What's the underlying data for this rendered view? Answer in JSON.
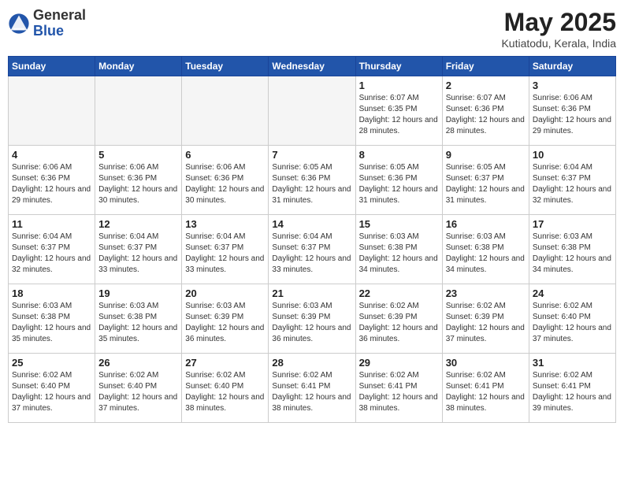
{
  "header": {
    "logo_general": "General",
    "logo_blue": "Blue",
    "month_year": "May 2025",
    "location": "Kutiatodu, Kerala, India"
  },
  "days_of_week": [
    "Sunday",
    "Monday",
    "Tuesday",
    "Wednesday",
    "Thursday",
    "Friday",
    "Saturday"
  ],
  "weeks": [
    [
      {
        "day": "",
        "info": ""
      },
      {
        "day": "",
        "info": ""
      },
      {
        "day": "",
        "info": ""
      },
      {
        "day": "",
        "info": ""
      },
      {
        "day": "1",
        "info": "Sunrise: 6:07 AM\nSunset: 6:35 PM\nDaylight: 12 hours and 28 minutes."
      },
      {
        "day": "2",
        "info": "Sunrise: 6:07 AM\nSunset: 6:36 PM\nDaylight: 12 hours and 28 minutes."
      },
      {
        "day": "3",
        "info": "Sunrise: 6:06 AM\nSunset: 6:36 PM\nDaylight: 12 hours and 29 minutes."
      }
    ],
    [
      {
        "day": "4",
        "info": "Sunrise: 6:06 AM\nSunset: 6:36 PM\nDaylight: 12 hours and 29 minutes."
      },
      {
        "day": "5",
        "info": "Sunrise: 6:06 AM\nSunset: 6:36 PM\nDaylight: 12 hours and 30 minutes."
      },
      {
        "day": "6",
        "info": "Sunrise: 6:06 AM\nSunset: 6:36 PM\nDaylight: 12 hours and 30 minutes."
      },
      {
        "day": "7",
        "info": "Sunrise: 6:05 AM\nSunset: 6:36 PM\nDaylight: 12 hours and 31 minutes."
      },
      {
        "day": "8",
        "info": "Sunrise: 6:05 AM\nSunset: 6:36 PM\nDaylight: 12 hours and 31 minutes."
      },
      {
        "day": "9",
        "info": "Sunrise: 6:05 AM\nSunset: 6:37 PM\nDaylight: 12 hours and 31 minutes."
      },
      {
        "day": "10",
        "info": "Sunrise: 6:04 AM\nSunset: 6:37 PM\nDaylight: 12 hours and 32 minutes."
      }
    ],
    [
      {
        "day": "11",
        "info": "Sunrise: 6:04 AM\nSunset: 6:37 PM\nDaylight: 12 hours and 32 minutes."
      },
      {
        "day": "12",
        "info": "Sunrise: 6:04 AM\nSunset: 6:37 PM\nDaylight: 12 hours and 33 minutes."
      },
      {
        "day": "13",
        "info": "Sunrise: 6:04 AM\nSunset: 6:37 PM\nDaylight: 12 hours and 33 minutes."
      },
      {
        "day": "14",
        "info": "Sunrise: 6:04 AM\nSunset: 6:37 PM\nDaylight: 12 hours and 33 minutes."
      },
      {
        "day": "15",
        "info": "Sunrise: 6:03 AM\nSunset: 6:38 PM\nDaylight: 12 hours and 34 minutes."
      },
      {
        "day": "16",
        "info": "Sunrise: 6:03 AM\nSunset: 6:38 PM\nDaylight: 12 hours and 34 minutes."
      },
      {
        "day": "17",
        "info": "Sunrise: 6:03 AM\nSunset: 6:38 PM\nDaylight: 12 hours and 34 minutes."
      }
    ],
    [
      {
        "day": "18",
        "info": "Sunrise: 6:03 AM\nSunset: 6:38 PM\nDaylight: 12 hours and 35 minutes."
      },
      {
        "day": "19",
        "info": "Sunrise: 6:03 AM\nSunset: 6:38 PM\nDaylight: 12 hours and 35 minutes."
      },
      {
        "day": "20",
        "info": "Sunrise: 6:03 AM\nSunset: 6:39 PM\nDaylight: 12 hours and 36 minutes."
      },
      {
        "day": "21",
        "info": "Sunrise: 6:03 AM\nSunset: 6:39 PM\nDaylight: 12 hours and 36 minutes."
      },
      {
        "day": "22",
        "info": "Sunrise: 6:02 AM\nSunset: 6:39 PM\nDaylight: 12 hours and 36 minutes."
      },
      {
        "day": "23",
        "info": "Sunrise: 6:02 AM\nSunset: 6:39 PM\nDaylight: 12 hours and 37 minutes."
      },
      {
        "day": "24",
        "info": "Sunrise: 6:02 AM\nSunset: 6:40 PM\nDaylight: 12 hours and 37 minutes."
      }
    ],
    [
      {
        "day": "25",
        "info": "Sunrise: 6:02 AM\nSunset: 6:40 PM\nDaylight: 12 hours and 37 minutes."
      },
      {
        "day": "26",
        "info": "Sunrise: 6:02 AM\nSunset: 6:40 PM\nDaylight: 12 hours and 37 minutes."
      },
      {
        "day": "27",
        "info": "Sunrise: 6:02 AM\nSunset: 6:40 PM\nDaylight: 12 hours and 38 minutes."
      },
      {
        "day": "28",
        "info": "Sunrise: 6:02 AM\nSunset: 6:41 PM\nDaylight: 12 hours and 38 minutes."
      },
      {
        "day": "29",
        "info": "Sunrise: 6:02 AM\nSunset: 6:41 PM\nDaylight: 12 hours and 38 minutes."
      },
      {
        "day": "30",
        "info": "Sunrise: 6:02 AM\nSunset: 6:41 PM\nDaylight: 12 hours and 38 minutes."
      },
      {
        "day": "31",
        "info": "Sunrise: 6:02 AM\nSunset: 6:41 PM\nDaylight: 12 hours and 39 minutes."
      }
    ]
  ]
}
